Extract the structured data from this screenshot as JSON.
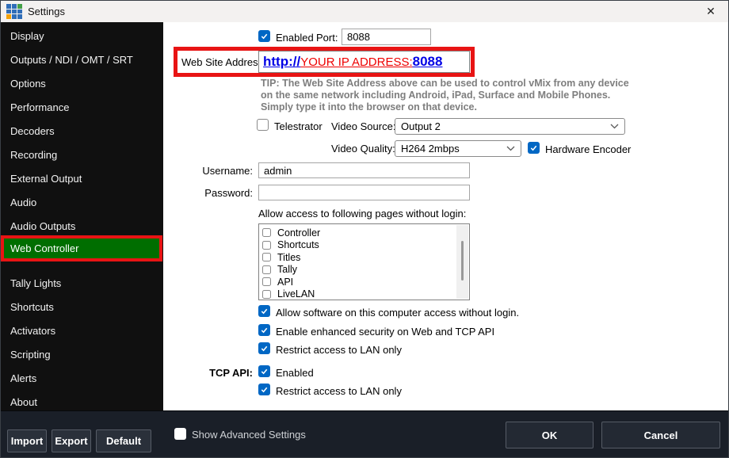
{
  "window": {
    "title": "Settings",
    "close": "✕",
    "icon": "vmix-grid-icon"
  },
  "colors": {
    "annotation_red": "#e81414",
    "active_green": "#006e00",
    "checkbox_blue": "#0067c4",
    "link_blue": "#0000e6",
    "link_red": "#ee0000"
  },
  "sidebar": {
    "items": [
      "Display",
      "Outputs / NDI / OMT / SRT",
      "Options",
      "Performance",
      "Decoders",
      "Recording",
      "External Output",
      "Audio",
      "Audio Outputs",
      "Web Controller",
      "Tally Lights",
      "Shortcuts",
      "Activators",
      "Scripting",
      "Alerts",
      "About"
    ],
    "active_item": "Web Controller"
  },
  "footer": {
    "import": "Import",
    "export": "Export",
    "default": "Default",
    "show_advanced": "Show Advanced Settings",
    "ok": "OK",
    "cancel": "Cancel"
  },
  "web_controller": {
    "enabled_label": "Enabled",
    "port_label": "Port:",
    "port_value": "8088",
    "website_label": "Web Site Address:",
    "url": {
      "scheme": "http://",
      "host": "YOUR IP ADDRESS",
      "colon": ":",
      "port": "8088"
    },
    "tip_lines": [
      "TIP: The Web Site Address above can be used to control vMix from any device",
      "on the same network including Android, iPad, Surface and Mobile Phones.",
      "Simply type it into the browser on that device."
    ],
    "telestrator_label": "Telestrator",
    "video_source_label": "Video Source:",
    "video_source_value": "Output 2",
    "video_quality_label": "Video Quality:",
    "video_quality_value": "H264 2mbps",
    "hardware_encoder_label": "Hardware Encoder",
    "username_label": "Username:",
    "username_value": "admin",
    "password_label": "Password:",
    "password_value": "",
    "allow_pages_label": "Allow access to following pages without login:",
    "page_options": [
      "Controller",
      "Shortcuts",
      "Titles",
      "Tally",
      "API",
      "LiveLAN"
    ],
    "allow_software_label": "Allow software on this computer access without login.",
    "enhanced_security_label": "Enable enhanced security on Web and TCP API",
    "restrict_lan_label": "Restrict access to LAN only",
    "tcp_api_label": "TCP API:",
    "tcp_enabled_label": "Enabled",
    "tcp_restrict_label": "Restrict access to LAN only"
  }
}
